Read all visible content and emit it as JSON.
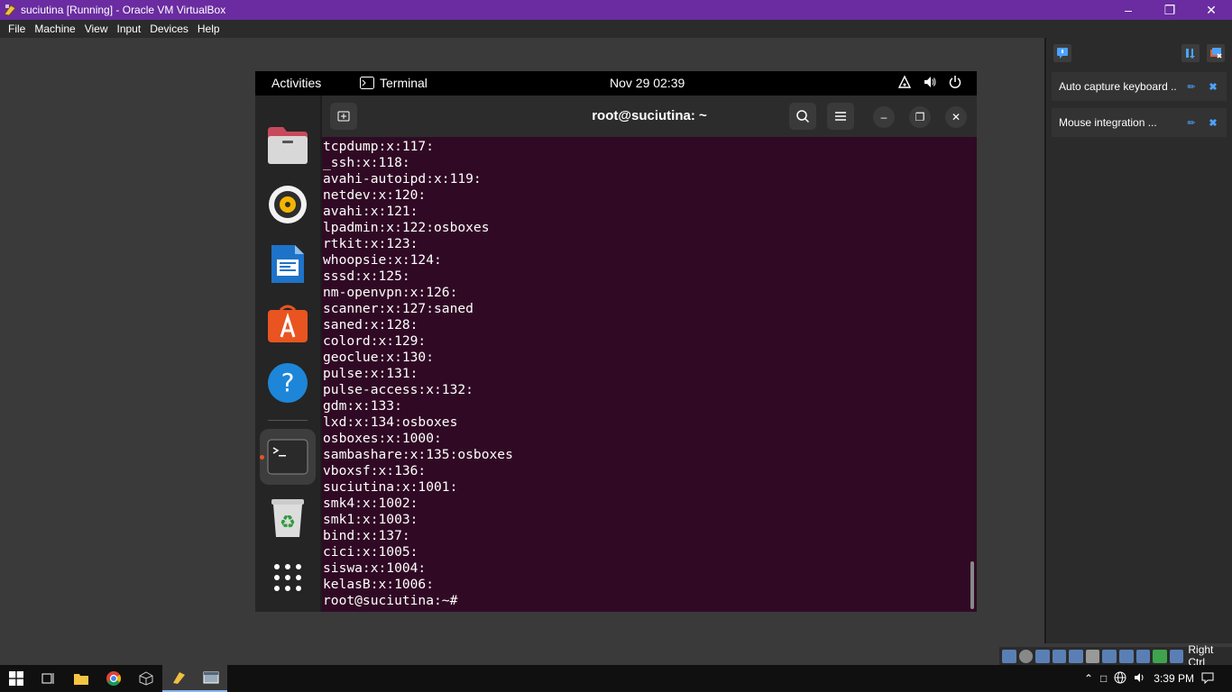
{
  "window": {
    "title": "suciutina [Running] - Oracle VM VirtualBox",
    "menu": [
      "File",
      "Machine",
      "View",
      "Input",
      "Devices",
      "Help"
    ]
  },
  "guest": {
    "topbar": {
      "activities": "Activities",
      "app": "Terminal",
      "clock": "Nov 29  02:39"
    },
    "terminal": {
      "title": "root@suciutina: ~",
      "lines": [
        "tcpdump:x:117:",
        "_ssh:x:118:",
        "avahi-autoipd:x:119:",
        "netdev:x:120:",
        "avahi:x:121:",
        "lpadmin:x:122:osboxes",
        "rtkit:x:123:",
        "whoopsie:x:124:",
        "sssd:x:125:",
        "nm-openvpn:x:126:",
        "scanner:x:127:saned",
        "saned:x:128:",
        "colord:x:129:",
        "geoclue:x:130:",
        "pulse:x:131:",
        "pulse-access:x:132:",
        "gdm:x:133:",
        "lxd:x:134:osboxes",
        "osboxes:x:1000:",
        "sambashare:x:135:osboxes",
        "vboxsf:x:136:",
        "suciutina:x:1001:",
        "smk4:x:1002:",
        "smk1:x:1003:",
        "bind:x:137:",
        "cici:x:1005:",
        "siswa:x:1004:",
        "kelasB:x:1006:",
        "root@suciutina:~#"
      ]
    },
    "dock": [
      "files-icon",
      "rhythmbox-icon",
      "writer-icon",
      "app-center-icon",
      "help-icon",
      "terminal-icon",
      "trash-icon",
      "show-apps-icon"
    ]
  },
  "notifications": [
    {
      "text": "Auto capture keyboard ..."
    },
    {
      "text": "Mouse integration ..."
    }
  ],
  "status": {
    "host_key": "Right Ctrl"
  },
  "taskbar": {
    "time": "3:39 PM"
  },
  "colors": {
    "titlebar": "#6a2ca0",
    "terminal_bg": "#300a24",
    "ubuntu_orange": "#e95420"
  }
}
